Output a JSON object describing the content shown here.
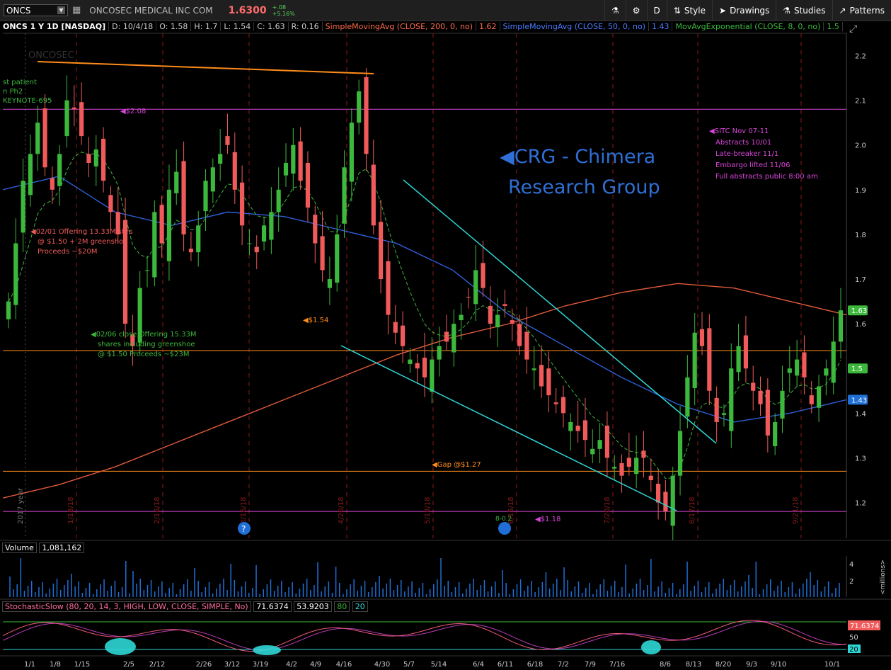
{
  "toolbar": {
    "symbol": "ONCS",
    "company": "ONCOSEC MEDICAL INC COM",
    "last": "1.6300",
    "change_abs": "+.08",
    "change_pct": "+5.16%",
    "aggregation": "D",
    "style_label": "Style",
    "drawings_label": "Drawings",
    "studies_label": "Studies",
    "patterns_label": "Patterns"
  },
  "header": {
    "title": "ONCS 1 Y 1D [NASDAQ]",
    "date": "D: 10/4/18",
    "open": "O: 1.58",
    "high": "H: 1.7",
    "low": "L: 1.54",
    "close": "C: 1.63",
    "range": "R: 0.16",
    "sma200": "SimpleMovingAvg (CLOSE, 200, 0, no)",
    "sma200_val": "1.62",
    "sma50": "SimpleMovingAvg (CLOSE, 50, 0, no)",
    "sma50_val": "1.43",
    "ema8": "MovAvgExponential (CLOSE, 8, 0, no)",
    "ema8_val": "1.5"
  },
  "chart_data": {
    "type": "candlestick",
    "title": "ONCS 1 Y 1D [NASDAQ]",
    "ylim": [
      1.12,
      2.25
    ],
    "y_ticks": [
      1.2,
      1.3,
      1.4,
      1.5,
      1.6,
      1.7,
      1.8,
      1.9,
      2.0,
      2.1,
      2.2
    ],
    "x_ticks": [
      "1/1",
      "1/8",
      "1/15",
      "2/5",
      "2/12",
      "2/26",
      "3/12",
      "3/19",
      "4/2",
      "4/9",
      "4/16",
      "4/30",
      "5/7",
      "5/14",
      "6/4",
      "6/11",
      "6/18",
      "7/2",
      "7/9",
      "7/16",
      "8/6",
      "8/13",
      "8/20",
      "9/3",
      "9/10",
      "10/1"
    ],
    "year_label": "2017 year",
    "close_approx": [
      1.65,
      1.78,
      1.92,
      1.98,
      2.05,
      1.95,
      1.9,
      1.98,
      2.1,
      2.08,
      2.02,
      1.96,
      1.99,
      1.92,
      1.85,
      1.8,
      1.6,
      1.55,
      1.68,
      1.72,
      1.85,
      1.78,
      1.9,
      1.94,
      1.8,
      1.76,
      1.82,
      1.92,
      1.95,
      1.98,
      2.0,
      1.9,
      1.82,
      1.78,
      1.76,
      1.82,
      1.85,
      1.9,
      1.96,
      2.0,
      1.92,
      1.86,
      1.78,
      1.72,
      1.7,
      1.8,
      1.95,
      2.05,
      2.12,
      1.98,
      1.82,
      1.7,
      1.62,
      1.58,
      1.55,
      1.52,
      1.5,
      1.48,
      1.52,
      1.55,
      1.56,
      1.6,
      1.62,
      1.66,
      1.72,
      1.68,
      1.6,
      1.62,
      1.64,
      1.6,
      1.55,
      1.52,
      1.5,
      1.46,
      1.44,
      1.42,
      1.4,
      1.38,
      1.36,
      1.34,
      1.32,
      1.34,
      1.3,
      1.28,
      1.26,
      1.28,
      1.3,
      1.3,
      1.25,
      1.2,
      1.18,
      1.26,
      1.36,
      1.48,
      1.58,
      1.55,
      1.45,
      1.38,
      1.4,
      1.5,
      1.55,
      1.5,
      1.45,
      1.42,
      1.35,
      1.38,
      1.45,
      1.5,
      1.52,
      1.48,
      1.42,
      1.46,
      1.5,
      1.56,
      1.63
    ],
    "sma200_approx": [
      1.21,
      1.24,
      1.28,
      1.33,
      1.38,
      1.43,
      1.48,
      1.53,
      1.57,
      1.6,
      1.64,
      1.67,
      1.69,
      1.68,
      1.65,
      1.62
    ],
    "sma50_approx": [
      1.9,
      1.93,
      1.85,
      1.82,
      1.85,
      1.84,
      1.81,
      1.78,
      1.72,
      1.62,
      1.55,
      1.48,
      1.42,
      1.38,
      1.4,
      1.43
    ],
    "h_lines": [
      {
        "value": 2.08,
        "label": "$2.08",
        "color": "#d946d9"
      },
      {
        "value": 1.54,
        "label": "$1.54",
        "color": "#ff8c1a"
      },
      {
        "value": 1.27,
        "label": "Gap @$1.27",
        "color": "#ff8c1a"
      },
      {
        "value": 1.18,
        "label": "$1.18",
        "color": "#d946d9"
      }
    ],
    "price_labels": [
      {
        "value": 1.63,
        "text": "1.63",
        "color": "#3cb83c"
      },
      {
        "value": 1.5,
        "text": "1.5",
        "color": "#3cb83c"
      },
      {
        "value": 1.43,
        "text": "1.43",
        "color": "#1f6fd6"
      }
    ],
    "annotations": {
      "left_top": [
        "st patient",
        "n Ph2",
        "KEYNOTE-695"
      ],
      "offering1": [
        "02/01 Offering 13.33M shrs",
        "@ $1.50 + 2M greenshoe",
        "Proceeds ~$20M"
      ],
      "offering2": [
        "02/06 close Offering 15.33M",
        "shares including greenshoe",
        "@ $1.50 Proceeds ~$23M"
      ],
      "crg": [
        "CRG  -  Chimera",
        "Research Group"
      ],
      "sitc": [
        "SITC Nov 07-11",
        "Abstracts 10/01",
        "Late-breaker 11/1",
        "Embargo lifted 11/06",
        "Full abstracts public 8:00 am"
      ],
      "watermark": "ONCOSEC",
      "lightbulb_label": "8-0.2",
      "event_dates": [
        "1/18/18",
        "2/16/18",
        "3/16/18",
        "4/20/18",
        "5/18/18",
        "6/15/18",
        "7/20/18",
        "8/17/18",
        "9/21/18"
      ]
    }
  },
  "volume": {
    "label": "Volume",
    "value": "1,081,162",
    "axis_unit": "<millions>",
    "ticks": [
      "4",
      "2"
    ]
  },
  "stochastic": {
    "label": "StochasticSlow (80, 20, 14, 3, HIGH, LOW, CLOSE, SIMPLE, No)",
    "k_val": "71.6374",
    "d_val": "53.9203",
    "ob": "80",
    "os": "20",
    "axis_ticks": [
      "50"
    ],
    "right_k": "71.6374",
    "right_os": "20"
  },
  "colors": {
    "up": "#3cb83c",
    "down": "#f05a5a",
    "sma200": "#e05a3a",
    "sma50": "#2f5fd6",
    "ema8": "#3cb83c",
    "trend": "#2fd6d6",
    "resistance": "#ff8c1a"
  }
}
